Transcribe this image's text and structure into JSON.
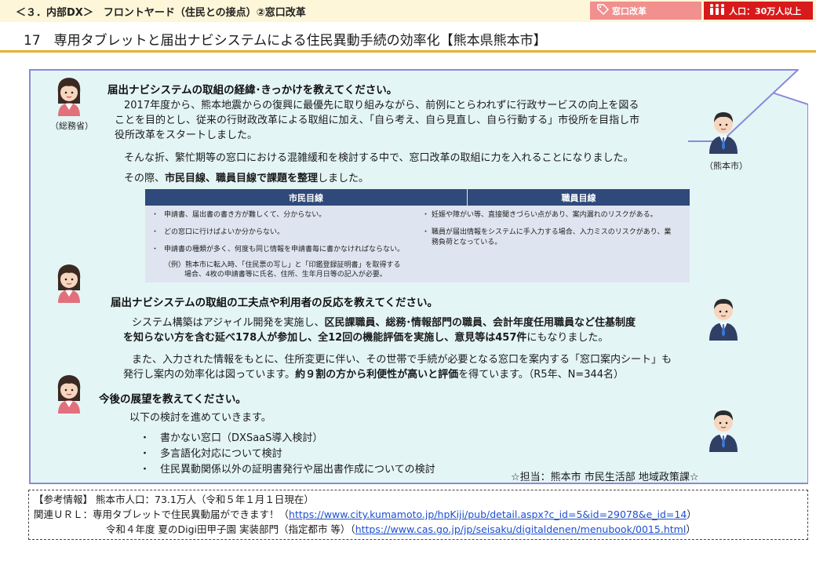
{
  "header": {
    "chapter": "＜３．内部DX＞　フロントヤード（住民との接点）②窓口改革",
    "tags": {
      "madoguchi": "窓口改革",
      "population": "人口：30万人以上"
    },
    "colors": {
      "madoguchi_tag": "#f28f8f",
      "population_tag": "#d81a1a",
      "rule": "#e8b12c",
      "panel_fill": "#e4f5f6",
      "panel_border": "#8a8ad8",
      "table_header": "#2f4a7a"
    }
  },
  "title": "17　専用タブレットと届出ナビシステムによる住民異動手続の効率化【熊本県熊本市】",
  "avatars": {
    "soumusho_caption": "（総務省）",
    "kumamoto_caption": "（熊本市）"
  },
  "section1": {
    "heading": "届出ナビシステムの取組の経緯･きっかけを教えてください。",
    "p1_line1": "2017年度から、熊本地震からの復興に最優先に取り組みながら、前例にとらわれずに行政サービスの向上を図る",
    "p1_line2": "ことを目的とし、従来の行財政改革による取組に加え、「自ら考え、自ら見直し、自ら行動する」市役所を目指し市",
    "p1_line3": "役所改革をスタートしました。",
    "p2": "そんな折、繁忙期等の窓口における混雑緩和を検討する中で、窓口改革の取組に力を入れることになりました。",
    "p3_prefix": "その際、",
    "p3_bold": "市民目線、職員目線で課題を整理",
    "p3_suffix": "しました。"
  },
  "table": {
    "headers": [
      "市民目線",
      "職員目線"
    ],
    "citizen": [
      "申請書、届出書の書き方が難しくて、分からない。",
      "どの窓口に行けばよいか分からない。",
      "申請書の種類が多く、何度も同じ情報を申請書毎に書かなければならない。"
    ],
    "citizen_example_1": "（例）熊本市に転入時、「住民票の写し」と「印鑑登録証明書」を取得する",
    "citizen_example_2": "場合、4枚の申請書等に氏名、住所、生年月日等の記入が必要。",
    "staff_1": "妊娠や障がい等、直接聞きづらい点があり、案内漏れのリスクがある。",
    "staff_2a": "職員が届出情報をシステムに手入力する場合、入力ミスのリスクがあり、業",
    "staff_2b": "務負荷となっている。",
    "bullet": "・"
  },
  "section2": {
    "heading": "届出ナビシステムの取組の工夫点や利用者の反応を教えてください。",
    "p1_a": "システム構築はアジャイル開発を実施し、",
    "p1_b": "区民課職員、総務･情報部門の職員、会計年度任用職員など住基制度",
    "p1_c": "を知らない方を含む延べ178人が参加し、全12回の機能評価を実施し、意見等は457件",
    "p1_d": "にもなりました。",
    "p2_line1": "また、入力された情報をもとに、住所変更に伴い、その世帯で手続が必要となる窓口を案内する「窓口案内シート」も",
    "p2_a": "発行し案内の効率化は図っています。",
    "p2_b": "約９割の方から利便性が高いと評価",
    "p2_c": "を得ています。（R5年、N=344名）"
  },
  "section3": {
    "heading": "今後の展望を教えてください。",
    "intro": "以下の検討を進めていきます。",
    "bullet": "・",
    "items": [
      "書かない窓口（DXSaaS導入検討）",
      "多言語化対応について検討",
      "住民異動関係以外の証明書発行や届出書作成についての検討"
    ],
    "tanto": "☆担当：熊本市 市民生活部 地域政策課☆"
  },
  "reference": {
    "label": "【参考情報】",
    "population": "熊本市人口：73.1万人（令和５年１月１日現在）",
    "url_label": "関連ＵＲＬ：",
    "link1_text_prefix": "専用タブレットで住民異動届ができます！（",
    "link1_url": "https://www.city.kumamoto.jp/hpKiji/pub/detail.aspx?c_id=5&id=29078&e_id=14",
    "link2_text_prefix": "令和４年度 夏のDigi田甲子園 実装部門（指定都市 等）（",
    "link2_url": "https://www.cas.go.jp/jp/seisaku/digitaldenen/menubook/0015.html",
    "close_paren": "）"
  }
}
